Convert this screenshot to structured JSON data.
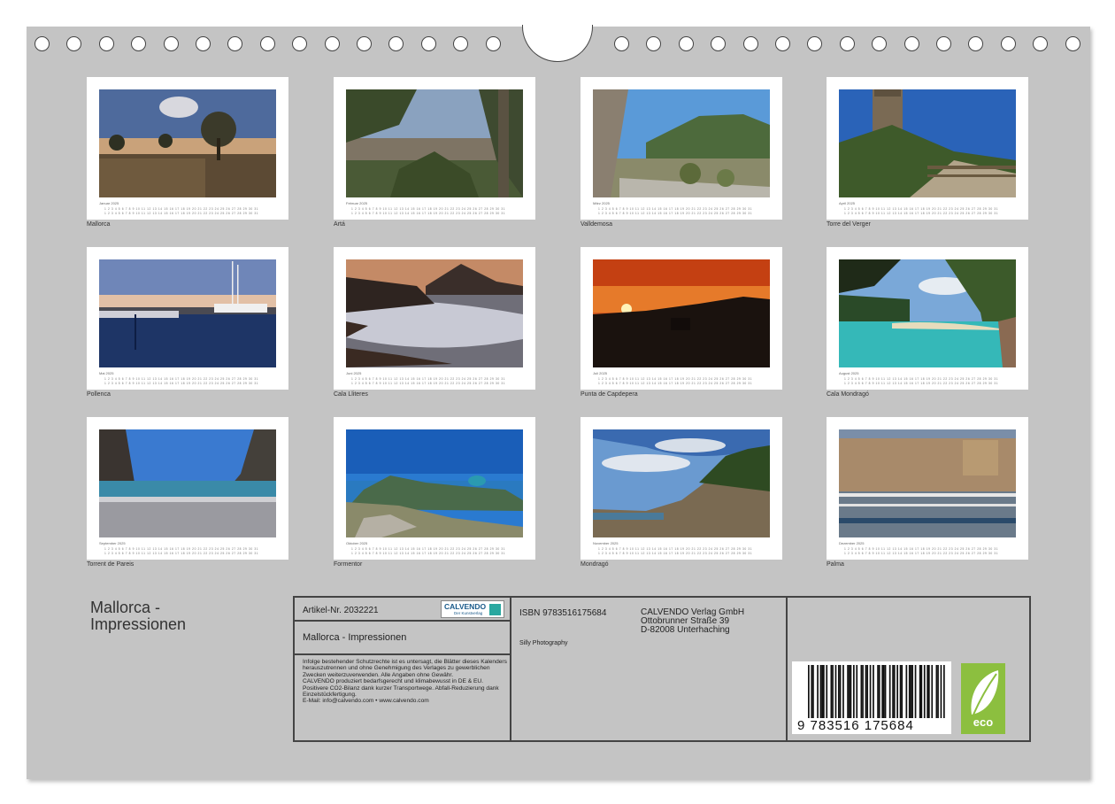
{
  "title": "Mallorca -\nImpressionen",
  "months": [
    {
      "month": "Januar 2025",
      "caption": "Mallorca"
    },
    {
      "month": "Februar 2025",
      "caption": "Artá"
    },
    {
      "month": "März 2025",
      "caption": "Valldemosa"
    },
    {
      "month": "April 2025",
      "caption": "Torre del Verger"
    },
    {
      "month": "Mai 2025",
      "caption": "Pollenca"
    },
    {
      "month": "Juni 2025",
      "caption": "Cala Lliteres"
    },
    {
      "month": "Juli 2025",
      "caption": "Punta de Capdepera"
    },
    {
      "month": "August 2025",
      "caption": "Cala Mondragó"
    },
    {
      "month": "September 2025",
      "caption": "Torrent de Pareis"
    },
    {
      "month": "Oktober 2025",
      "caption": "Formentor"
    },
    {
      "month": "November 2025",
      "caption": "Mondragó"
    },
    {
      "month": "Dezember 2025",
      "caption": "Palma"
    }
  ],
  "calendar_days": "1 2 3 4 5 6 7 8 9 10 11 12 13 14 15 16 17 18 19 20 21 22 23 24 25 26 27 28 29 30 31",
  "info": {
    "article": "Artikel-Nr. 2032221",
    "calvendo_logo": "CALVENDO",
    "calvendo_logo_sub": "Der Kunstverlag",
    "product_title": "Mallorca - Impressionen",
    "legal": "Infolge bestehender Schutzrechte ist es untersagt, die Blätter dieses Kalenders herauszutrennen und ohne Genehmigung des Verlages zu gewerblichen Zwecken weiterzuverwenden. Alle Angaben ohne Gewähr.\nCALVENDO produziert bedarfsgerecht und klimabewusst in DE & EU. Positivere CO2-Bilanz dank kurzer Transportwege. Abfall-Reduzierung dank Einzelstückfertigung.\nE-Mail: info@calvendo.com • www.calvendo.com",
    "isbn": "ISBN 9783516175684",
    "author": "Silly Photography",
    "publisher": [
      "CALVENDO Verlag GmbH",
      "Ottobrunner Straße 39",
      "D-82008 Unterhaching"
    ],
    "barcode_number": "9  783516  175684",
    "eco_label": "eco"
  }
}
